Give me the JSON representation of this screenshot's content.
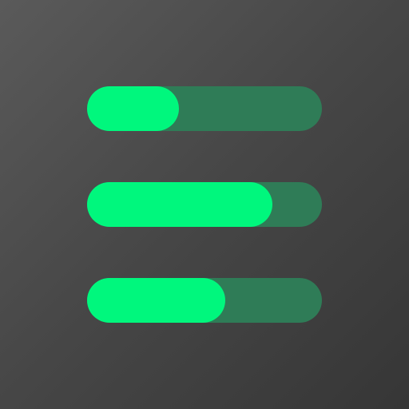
{
  "icon": {
    "name": "progress-bars-icon",
    "colors": {
      "fill": "#00f77d",
      "track": "#2f7c57",
      "background_light": "#5a5a5a",
      "background_dark": "#363636"
    },
    "bars": [
      {
        "fraction": 0.39
      },
      {
        "fraction": 0.79
      },
      {
        "fraction": 0.59
      }
    ]
  }
}
